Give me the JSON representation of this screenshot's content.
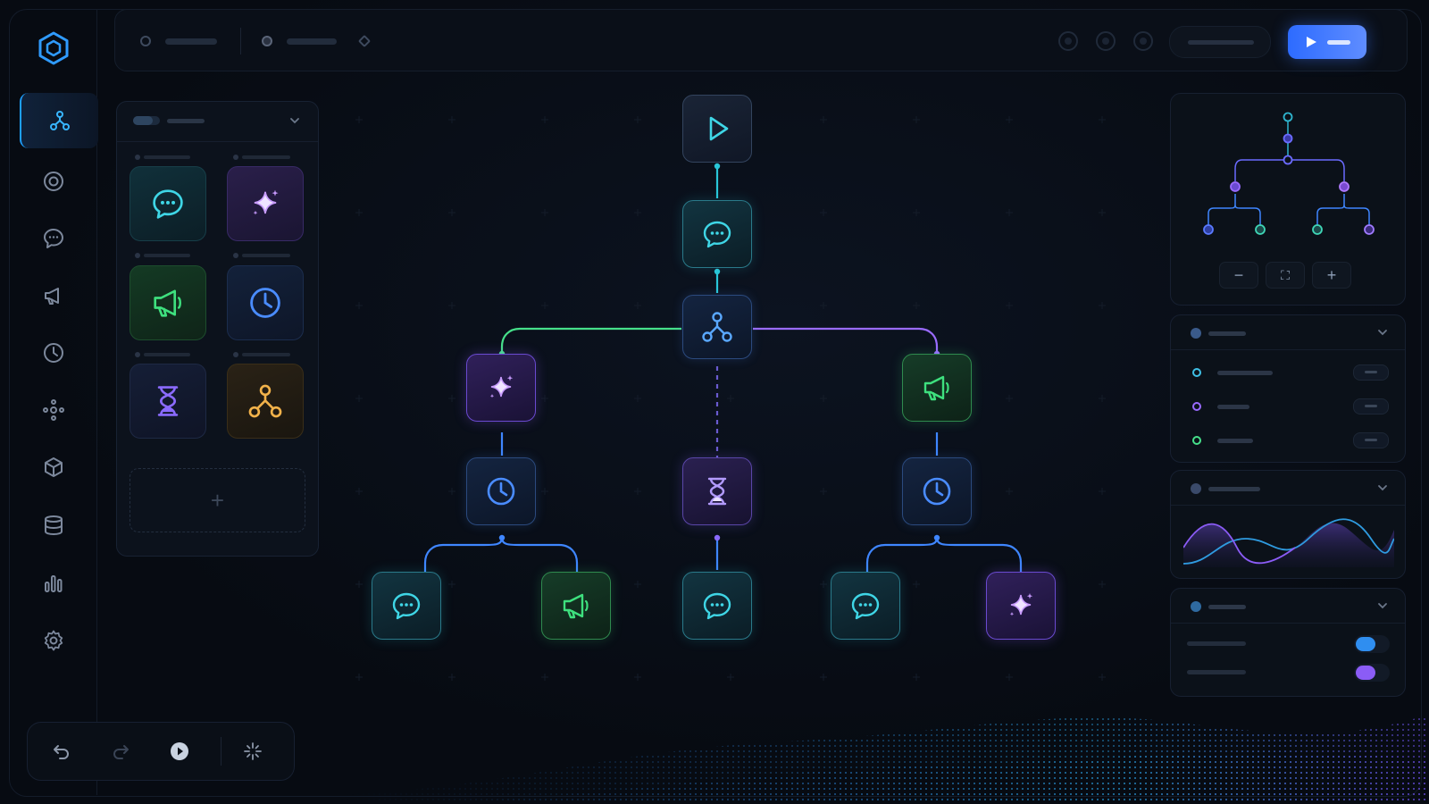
{
  "app": {
    "logo_icon": "hexagon-logo-icon",
    "accent": "#1ea0ff"
  },
  "rail": {
    "items": [
      {
        "id": "workflows",
        "icon": "flow-icon",
        "active": true
      },
      {
        "id": "target",
        "icon": "target-icon"
      },
      {
        "id": "chat",
        "icon": "chat-icon"
      },
      {
        "id": "campaigns",
        "icon": "megaphone-icon"
      },
      {
        "id": "history",
        "icon": "clock-icon"
      },
      {
        "id": "integrations",
        "icon": "nodes-icon"
      },
      {
        "id": "packages",
        "icon": "cube-icon"
      },
      {
        "id": "database",
        "icon": "database-icon"
      },
      {
        "id": "analytics",
        "icon": "bar-chart-icon"
      },
      {
        "id": "settings",
        "icon": "gear-icon"
      }
    ]
  },
  "topbar": {
    "run_button_icon": "play-icon",
    "run_button_color": "#3b76ff"
  },
  "palette": {
    "tiles": [
      {
        "kind": "message",
        "icon": "chat-icon",
        "color": "#3fd6e6"
      },
      {
        "kind": "ai",
        "icon": "sparkle-icon",
        "color": "#c89bff"
      },
      {
        "kind": "broadcast",
        "icon": "megaphone-icon",
        "color": "#3ee07e"
      },
      {
        "kind": "schedule",
        "icon": "clock-icon",
        "color": "#4a8cff"
      },
      {
        "kind": "delay",
        "icon": "hourglass-icon",
        "color": "#8b6bff"
      },
      {
        "kind": "branch",
        "icon": "flow-icon",
        "color": "#f2b24a"
      }
    ],
    "add_label": "+"
  },
  "canvas": {
    "nodes": [
      {
        "id": "trigger",
        "icon": "play-icon"
      },
      {
        "id": "message-1",
        "icon": "chat-icon"
      },
      {
        "id": "split",
        "icon": "flow-icon"
      },
      {
        "id": "ai-left",
        "icon": "sparkle-icon"
      },
      {
        "id": "broadcast-right",
        "icon": "megaphone-icon"
      },
      {
        "id": "schedule-left",
        "icon": "clock-icon"
      },
      {
        "id": "delay-center",
        "icon": "hourglass-icon"
      },
      {
        "id": "schedule-right",
        "icon": "clock-icon"
      },
      {
        "id": "message-ll",
        "icon": "chat-icon"
      },
      {
        "id": "broadcast-lr",
        "icon": "megaphone-icon"
      },
      {
        "id": "message-center",
        "icon": "chat-icon"
      },
      {
        "id": "message-rl",
        "icon": "chat-icon"
      },
      {
        "id": "ai-rr",
        "icon": "sparkle-icon"
      }
    ],
    "edge_colors": {
      "teal": "#29c6d8",
      "green": "#46e08a",
      "purple": "#9a6bff",
      "blue": "#3f86ff"
    }
  },
  "minimap": {
    "zoom_out_label": "−",
    "fit_label": "⛶",
    "zoom_in_label": "+"
  },
  "variables_panel": {
    "rows": [
      {
        "color": "#3fc0e6"
      },
      {
        "color": "#9a6bff"
      },
      {
        "color": "#46e08a"
      }
    ]
  },
  "metrics_panel": {
    "chart_icon": "wave-chart"
  },
  "toggles_panel": {
    "toggles": [
      {
        "on": true,
        "color": "#2f8ef0"
      },
      {
        "on": true,
        "color": "#8b5cf6"
      }
    ]
  },
  "bottombar": {
    "buttons": [
      {
        "id": "undo",
        "icon": "undo-icon"
      },
      {
        "id": "redo",
        "icon": "redo-icon"
      },
      {
        "id": "play",
        "icon": "play-circle-icon"
      },
      {
        "id": "magic",
        "icon": "sparkle-icon"
      }
    ]
  }
}
